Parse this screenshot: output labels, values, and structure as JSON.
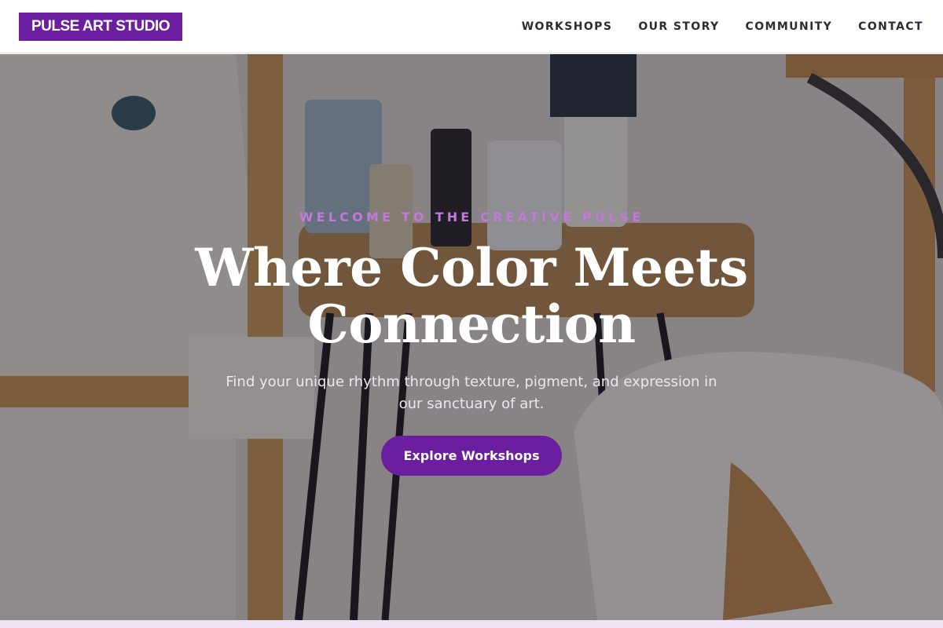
{
  "header": {
    "logo": "PULSE ART STUDIO",
    "nav": [
      {
        "label": "WORKSHOPS"
      },
      {
        "label": "OUR STORY"
      },
      {
        "label": "COMMUNITY"
      },
      {
        "label": "CONTACT"
      }
    ]
  },
  "hero": {
    "eyebrow": "WELCOME TO THE CREATIVE PULSE",
    "headline_line1": "Where Color Meets",
    "headline_line2": "Connection",
    "subtitle": "Find your unique rhythm through texture, pigment, and expression in our sanctuary of art.",
    "cta_label": "Explore Workshops",
    "background_image": "art-studio-photo"
  },
  "colors": {
    "brand": "#6b1f9e",
    "eyebrow": "#c07ad8",
    "overlay": "#140e18",
    "strip": "#efe3f5"
  }
}
